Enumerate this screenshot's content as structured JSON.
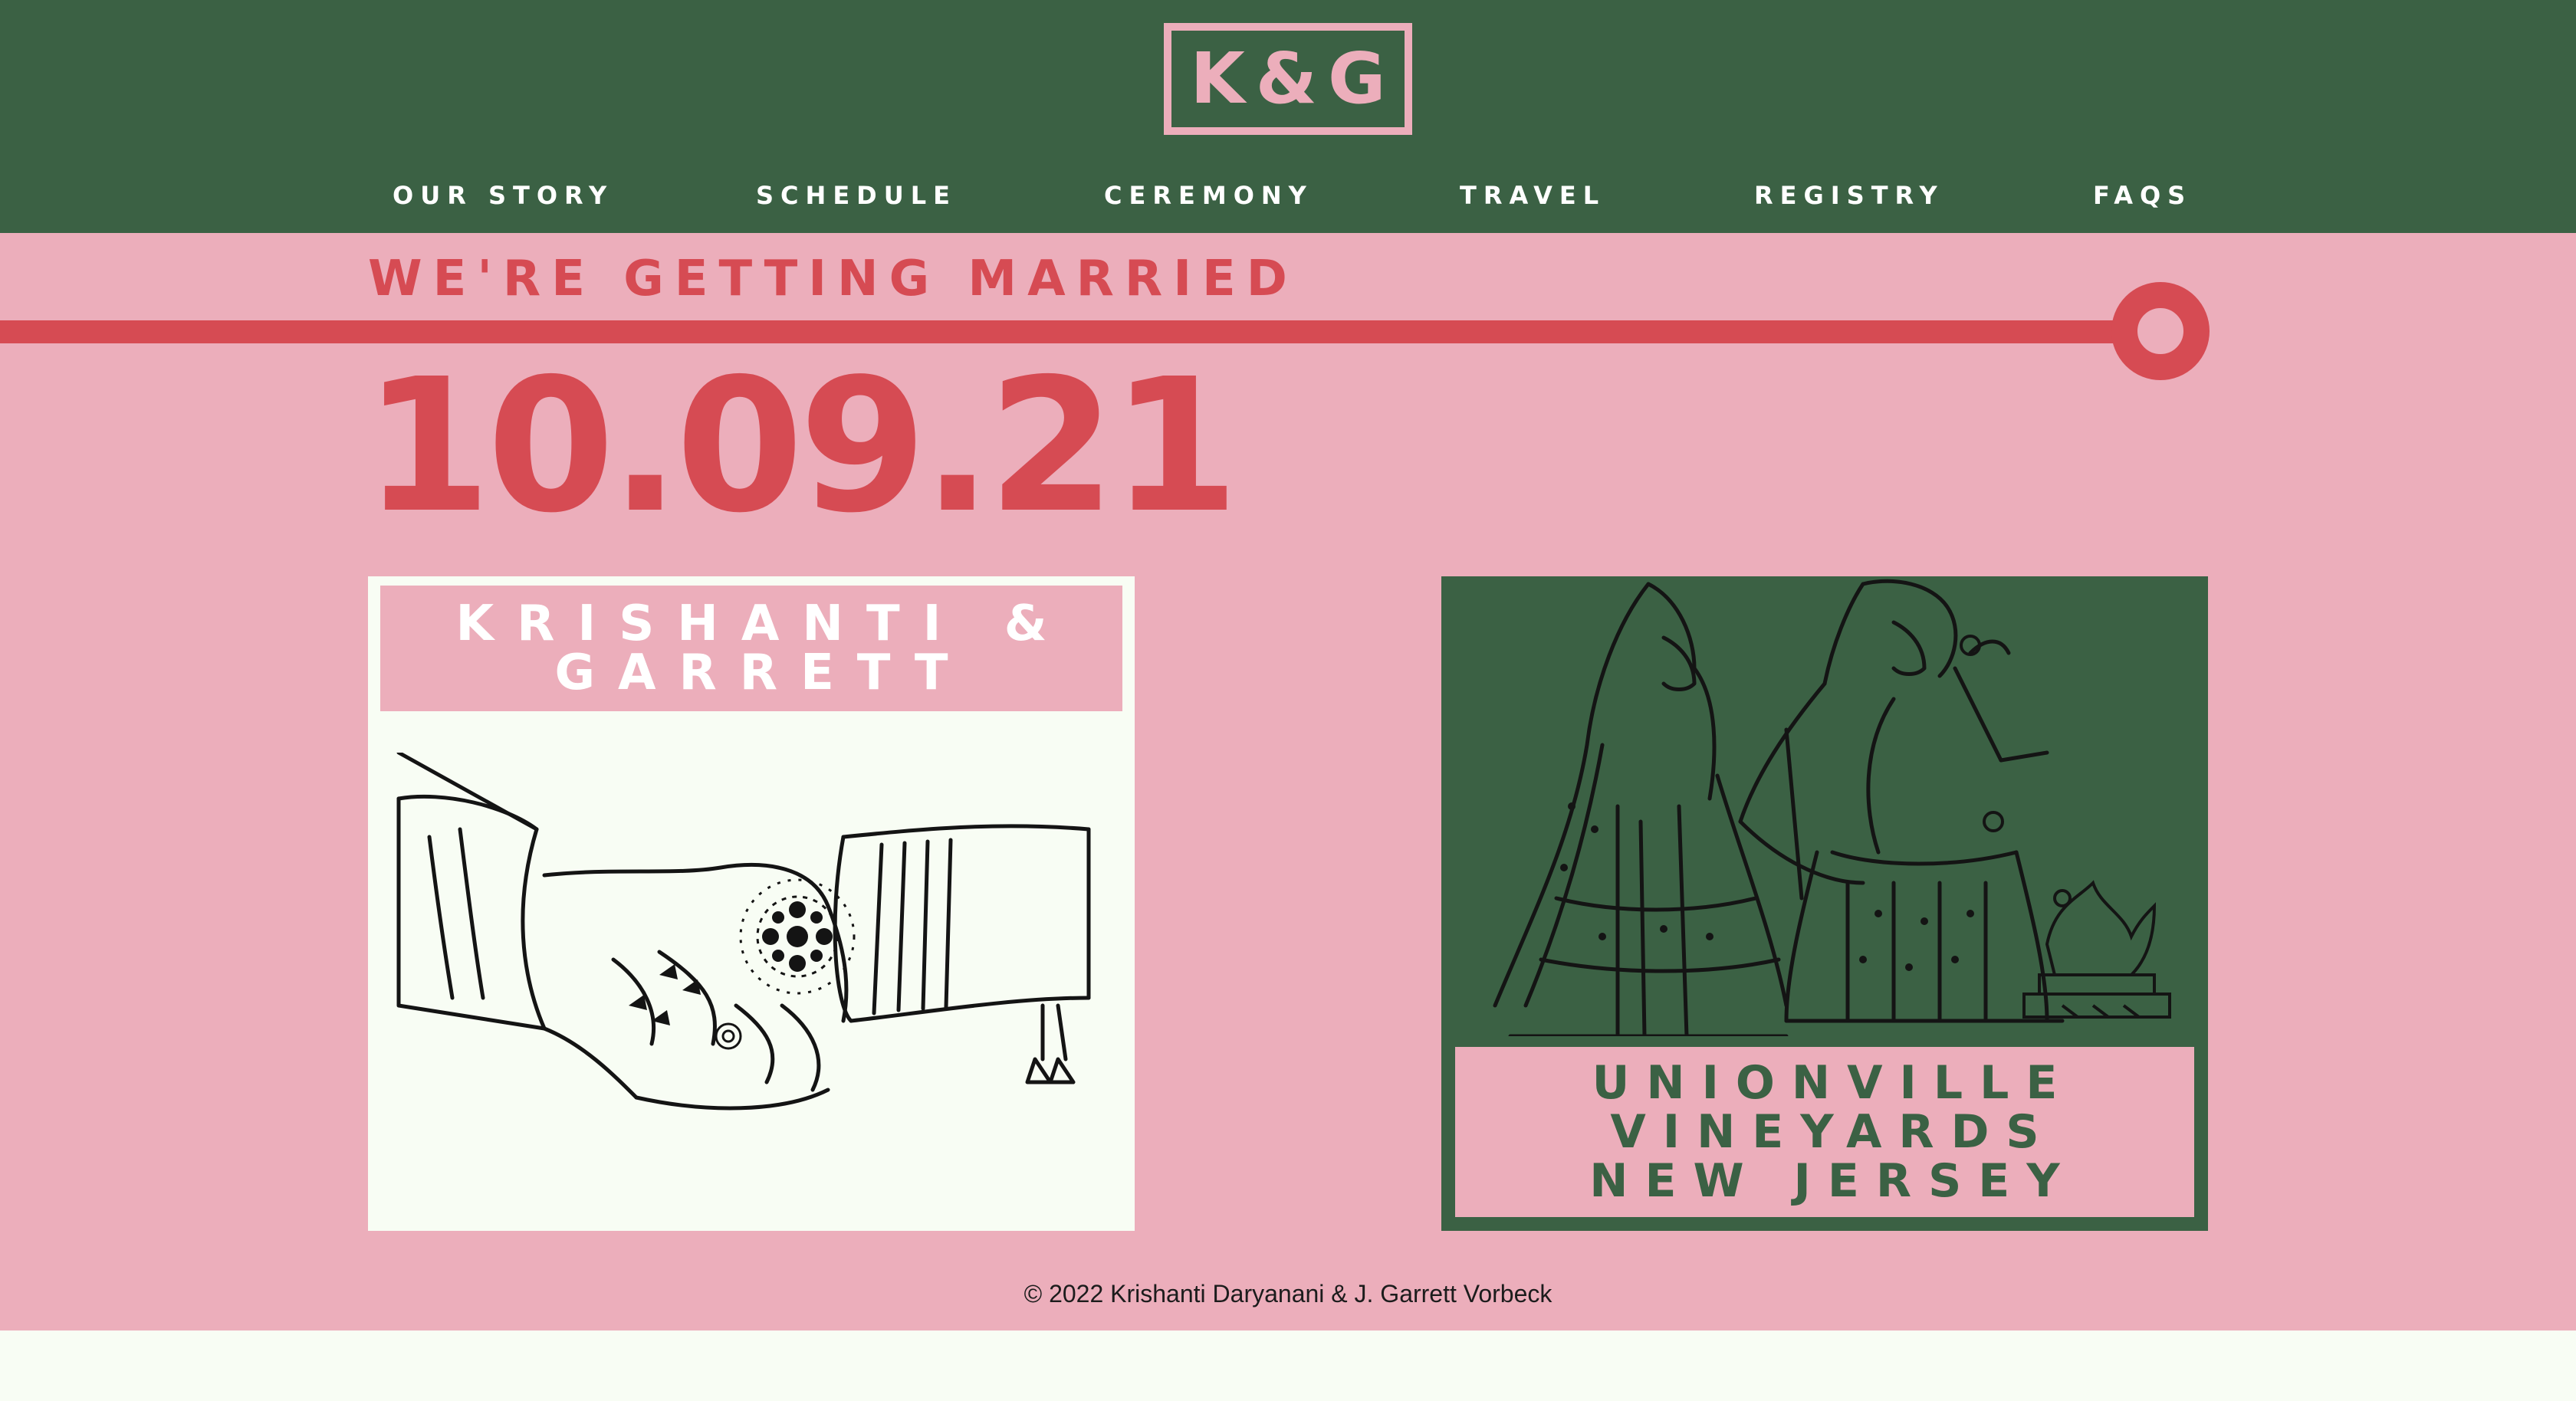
{
  "colors": {
    "header_green": "#3b6144",
    "pink": "#ecaebb",
    "red": "#d64b53",
    "cream": "#f8fdf4",
    "white": "#ffffff"
  },
  "header": {
    "logo": "K&G",
    "nav": [
      {
        "label": "OUR STORY"
      },
      {
        "label": "SCHEDULE"
      },
      {
        "label": "CEREMONY"
      },
      {
        "label": "TRAVEL"
      },
      {
        "label": "REGISTRY"
      },
      {
        "label": "FAQS"
      }
    ]
  },
  "hero": {
    "tagline": "WE'RE GETTING MARRIED",
    "date": "10.09.21"
  },
  "couple_card": {
    "names_line1": "KRISHANTI &",
    "names_line2": "GARRETT",
    "illustration": "hands-clasped-mehndi-illustration"
  },
  "venue_card": {
    "illustration": "wedding-couple-pheras-illustration",
    "line1": "UNIONVILLE",
    "line2": "VINEYARDS",
    "line3": "NEW JERSEY"
  },
  "footer": {
    "copyright": "© 2022 Krishanti Daryanani & J. Garrett Vorbeck"
  }
}
